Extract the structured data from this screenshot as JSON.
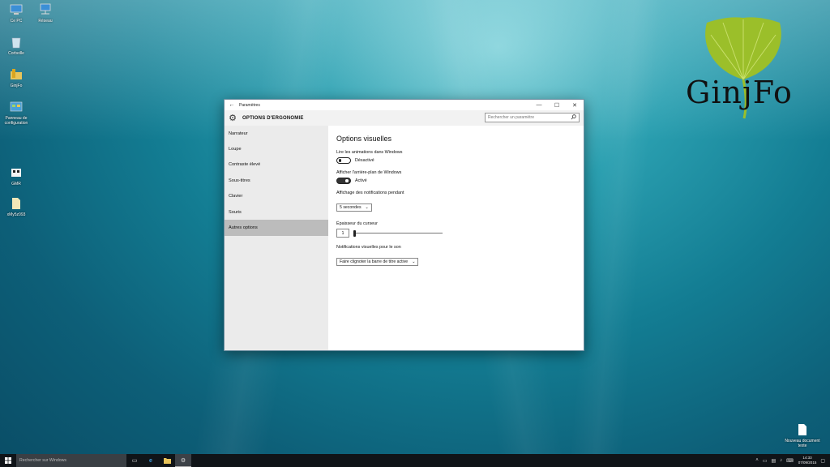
{
  "desktop": {
    "icons": [
      {
        "label": "Ce PC",
        "icon": "computer-icon"
      },
      {
        "label": "Réseau",
        "icon": "network-icon"
      },
      {
        "label": "Corbeille",
        "icon": "recycle-bin-icon"
      },
      {
        "label": "GinjFo",
        "icon": "folder-icon"
      },
      {
        "label": "Panneau de configuration",
        "icon": "control-panel-icon"
      },
      {
        "label": "GMR",
        "icon": "file-icon"
      },
      {
        "label": "xMy5z093",
        "icon": "file-icon"
      },
      {
        "label": "Nouveau document texte",
        "icon": "text-document-icon"
      }
    ],
    "logo_text": "GinjFo",
    "logo_color": "#9bbf2a"
  },
  "window": {
    "title": "Paramètres",
    "header_title": "OPTIONS D'ERGONOMIE",
    "search_placeholder": "Rechercher un paramètre",
    "controls": {
      "minimize": "—",
      "maximize": "☐",
      "close": "✕"
    },
    "back": "←",
    "sidebar": [
      {
        "label": "Narrateur"
      },
      {
        "label": "Loupe"
      },
      {
        "label": "Contraste élevé"
      },
      {
        "label": "Sous-titres"
      },
      {
        "label": "Clavier"
      },
      {
        "label": "Souris"
      },
      {
        "label": "Autres options",
        "active": true
      }
    ],
    "content": {
      "heading": "Options visuelles",
      "animations": {
        "label": "Lire les animations dans Windows",
        "state": "Désactivé",
        "on": false
      },
      "background": {
        "label": "Afficher l'arrière-plan de Windows",
        "state": "Activé",
        "on": true
      },
      "notifications": {
        "label": "Affichage des notifications pendant",
        "value": "5 secondes"
      },
      "cursor": {
        "label": "Épaisseur du curseur",
        "value": "1",
        "level": 0
      },
      "sound": {
        "label": "Notifications visuelles pour le son",
        "value": "Faire clignoter la barre de titre active"
      }
    }
  },
  "taskbar": {
    "search_placeholder": "Rechercher sur Windows",
    "clock_time": "14:33",
    "clock_date": "07/09/2015"
  }
}
